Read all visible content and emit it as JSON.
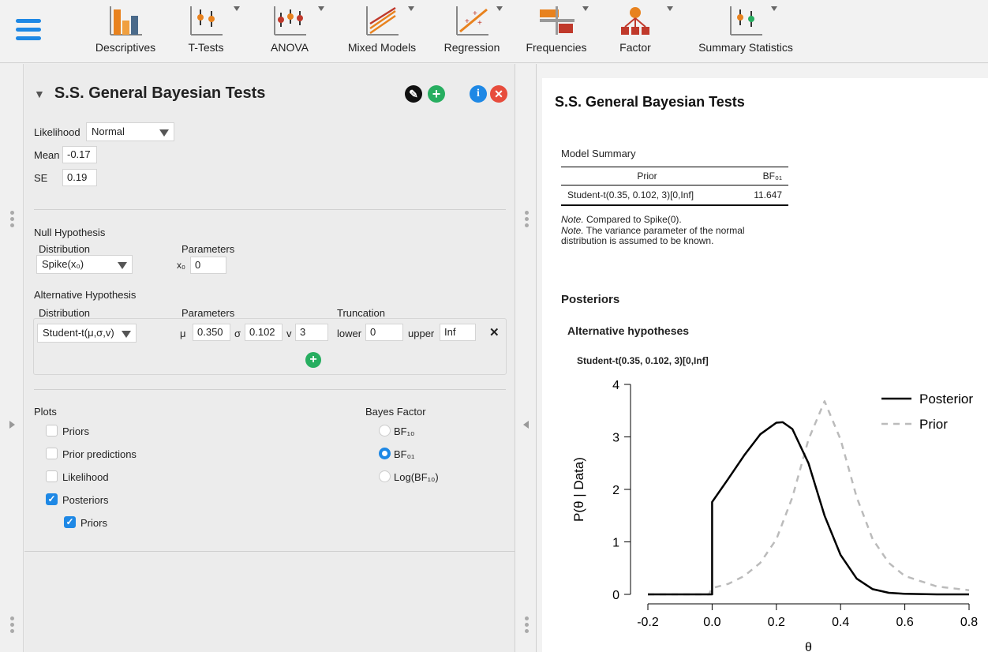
{
  "toolbar": {
    "items": [
      {
        "label": "Descriptives",
        "icon": "descriptives-bar-icon"
      },
      {
        "label": "T-Tests",
        "icon": "ttests-icon"
      },
      {
        "label": "ANOVA",
        "icon": "anova-icon"
      },
      {
        "label": "Mixed Models",
        "icon": "mixed-models-icon"
      },
      {
        "label": "Regression",
        "icon": "regression-icon"
      },
      {
        "label": "Frequencies",
        "icon": "frequencies-icon"
      },
      {
        "label": "Factor",
        "icon": "factor-icon"
      },
      {
        "label": "Summary Statistics",
        "icon": "summary-statistics-icon"
      }
    ]
  },
  "analysis": {
    "title": "S.S. General Bayesian Tests",
    "likelihood_label": "Likelihood",
    "likelihood_value": "Normal",
    "mean_label": "Mean",
    "mean_value": "-0.17",
    "se_label": "SE",
    "se_value": "0.19",
    "null": {
      "heading": "Null Hypothesis",
      "distribution_label": "Distribution",
      "parameters_label": "Parameters",
      "distribution_value": "Spike(x₀)",
      "x0_label": "x₀",
      "x0_value": "0"
    },
    "alt": {
      "heading": "Alternative Hypothesis",
      "distribution_label": "Distribution",
      "parameters_label": "Parameters",
      "truncation_label": "Truncation",
      "distribution_value": "Student-t(μ,σ,v)",
      "mu_label": "μ",
      "mu_value": "0.350",
      "sigma_label": "σ",
      "sigma_value": "0.102",
      "nu_label": "v",
      "nu_value": "3",
      "lower_label": "lower",
      "lower_value": "0",
      "upper_label": "upper",
      "upper_value": "Inf",
      "remove_symbol": "✕",
      "add_symbol": "+"
    },
    "plots": {
      "heading": "Plots",
      "items": [
        {
          "label": "Priors",
          "checked": false
        },
        {
          "label": "Prior predictions",
          "checked": false
        },
        {
          "label": "Likelihood",
          "checked": false
        },
        {
          "label": "Posteriors",
          "checked": true
        },
        {
          "label": "Priors",
          "checked": true
        }
      ]
    },
    "bayes_factor": {
      "heading": "Bayes Factor",
      "options": [
        {
          "label": "BF₁₀",
          "selected": false
        },
        {
          "label": "BF₀₁",
          "selected": true
        },
        {
          "label": "Log(BF₁₀)",
          "selected": false
        }
      ]
    }
  },
  "output": {
    "title": "S.S. General Bayesian Tests",
    "table_caption": "Model Summary",
    "col_prior": "Prior",
    "col_bf": "BF₀₁",
    "row_prior": "Student-t(0.35, 0.102, 3)[0,Inf]",
    "row_bf": "11.647",
    "note1_label": "Note.",
    "note1_text": " Compared to Spike(0).",
    "note2_label": "Note.",
    "note2_text": " The variance parameter of the normal distribution is assumed to be known.",
    "posteriors_heading": "Posteriors",
    "alt_heading": "Alternative hypotheses",
    "plot_title": "Student-t(0.35, 0.102, 3)[0,Inf]"
  },
  "chart_data": {
    "type": "line",
    "xlabel": "θ",
    "ylabel": "P(θ | Data)",
    "xlim": [
      -0.2,
      0.8
    ],
    "ylim": [
      0,
      4
    ],
    "xticks": [
      "-0.2",
      "0.0",
      "0.2",
      "0.4",
      "0.6",
      "0.8"
    ],
    "yticks": [
      "0",
      "1",
      "2",
      "3",
      "4"
    ],
    "legend_position": "top-right",
    "series": [
      {
        "name": "Posterior",
        "color": "#000000",
        "dash": "solid",
        "x": [
          -0.2,
          -0.01,
          0.0,
          0.0,
          0.05,
          0.1,
          0.15,
          0.2,
          0.22,
          0.25,
          0.3,
          0.35,
          0.4,
          0.45,
          0.5,
          0.55,
          0.6,
          0.7,
          0.8
        ],
        "y": [
          0,
          0,
          0,
          1.76,
          2.2,
          2.65,
          3.05,
          3.27,
          3.28,
          3.15,
          2.5,
          1.5,
          0.75,
          0.3,
          0.1,
          0.03,
          0.01,
          0,
          0
        ]
      },
      {
        "name": "Prior",
        "color": "#bbbbbb",
        "dash": "dashed",
        "x": [
          -0.2,
          -0.01,
          0.0,
          0.05,
          0.1,
          0.15,
          0.2,
          0.25,
          0.3,
          0.35,
          0.4,
          0.45,
          0.5,
          0.55,
          0.6,
          0.7,
          0.8
        ],
        "y": [
          0,
          0,
          0.12,
          0.2,
          0.35,
          0.6,
          1.05,
          1.85,
          2.95,
          3.68,
          2.95,
          1.85,
          1.05,
          0.6,
          0.35,
          0.15,
          0.08
        ]
      }
    ]
  }
}
